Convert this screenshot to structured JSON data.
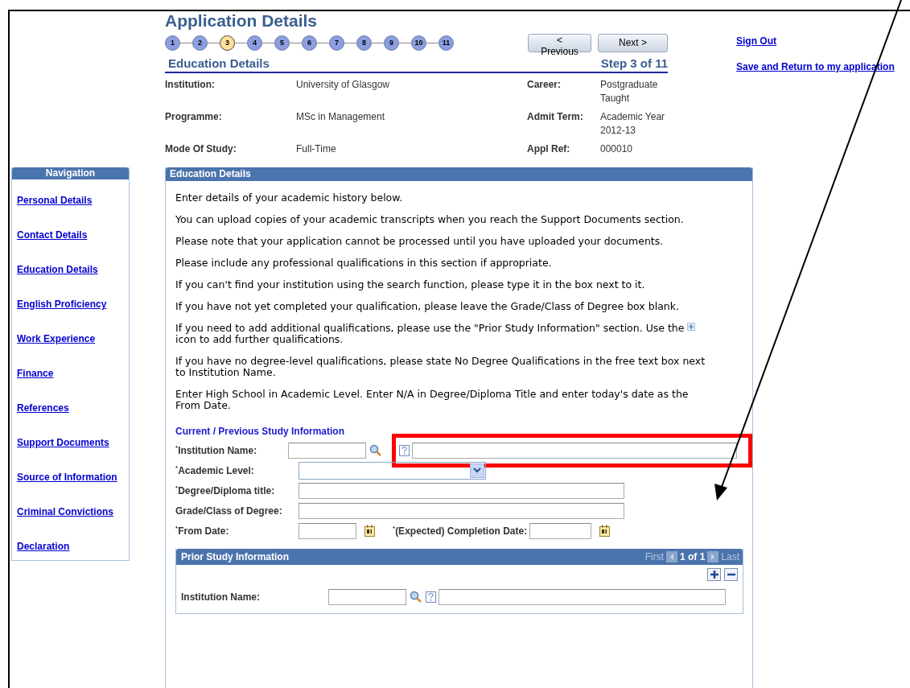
{
  "page_title": "Application Details",
  "steps": [
    {
      "label": "1",
      "selected": false
    },
    {
      "label": "2",
      "selected": false
    },
    {
      "label": "3",
      "selected": true
    },
    {
      "label": "4",
      "selected": false
    },
    {
      "label": "5",
      "selected": false
    },
    {
      "label": "6",
      "selected": false
    },
    {
      "label": "7",
      "selected": false
    },
    {
      "label": "8",
      "selected": false
    },
    {
      "label": "9",
      "selected": false
    },
    {
      "label": "10",
      "selected": false
    },
    {
      "label": "11",
      "selected": false
    }
  ],
  "buttons": [
    "< Previous",
    "Next >"
  ],
  "links": [
    "Sign Out",
    "Save and Return to my application"
  ],
  "section_title": "Education Details",
  "step_text": "Step 3 of 11",
  "summary": [
    {
      "label": "Institution:",
      "value": "University of Glasgow"
    },
    {
      "label": "Career:",
      "value": "Postgraduate Taught"
    },
    {
      "label": "Programme:",
      "value": "MSc in Management"
    },
    {
      "label": "Admit Term:",
      "value": "Academic Year 2012-13"
    },
    {
      "label": "Mode Of Study:",
      "value": "Full-Time"
    },
    {
      "label": "Appl Ref:",
      "value": "000010"
    }
  ],
  "navigation": {
    "title": "Navigation",
    "items": [
      "Personal Details",
      "Contact Details",
      "Education Details",
      "English Proficiency",
      "Work Experience",
      "Finance",
      "References",
      "Support Documents",
      "Source of Information",
      "Criminal Convictions",
      "Declaration"
    ]
  },
  "panel": {
    "title": "Education Details",
    "paragraphs": [
      {
        "text": "Enter details of your academic history below."
      },
      {
        "text": "You can upload copies of your academic transcripts when you reach the Support Documents section."
      },
      {
        "text": "Please note that your application cannot be processed until you have uploaded your documents."
      },
      {
        "text": "Please include any professional qualifications in this section if appropriate."
      },
      {
        "text": "If you can't find your institution using the search function, please type it in the box next to it."
      },
      {
        "text": "If you have not yet completed your qualification, please leave the Grade/Class of Degree box blank."
      },
      {
        "text": "If you need to add additional qualifications, please use the \"Prior Study Information\" section. Use the",
        "after_icon": "icon to add further qualifications."
      },
      {
        "text": "If you have no degree-level qualifications, please state No Degree Qualifications in the free text box next to Institution Name."
      },
      {
        "text": "Enter High School in Academic Level. Enter N/A in Degree/Diploma Title and enter today's date as the From Date."
      }
    ],
    "study_title": "Current / Previous Study Information",
    "fields": [
      {
        "kind": "lookup",
        "label": "$^{*}$Institution Name:"
      },
      {
        "kind": "select",
        "label": "$^{*}$Academic Level:"
      },
      {
        "kind": "text",
        "label": "$^{*}$Degree/Diploma title:"
      },
      {
        "kind": "text",
        "label": "Grade/Class of Degree:"
      },
      {
        "kind": "dates",
        "label": "$^{*}$From Date:",
        "second_label": "$^{*}$(Expected) Completion Date:"
      }
    ],
    "prior": {
      "title": "Prior Study Information",
      "first": "First",
      "count": "1 of 1",
      "last": "Last",
      "field_label": "Institution Name:"
    }
  }
}
